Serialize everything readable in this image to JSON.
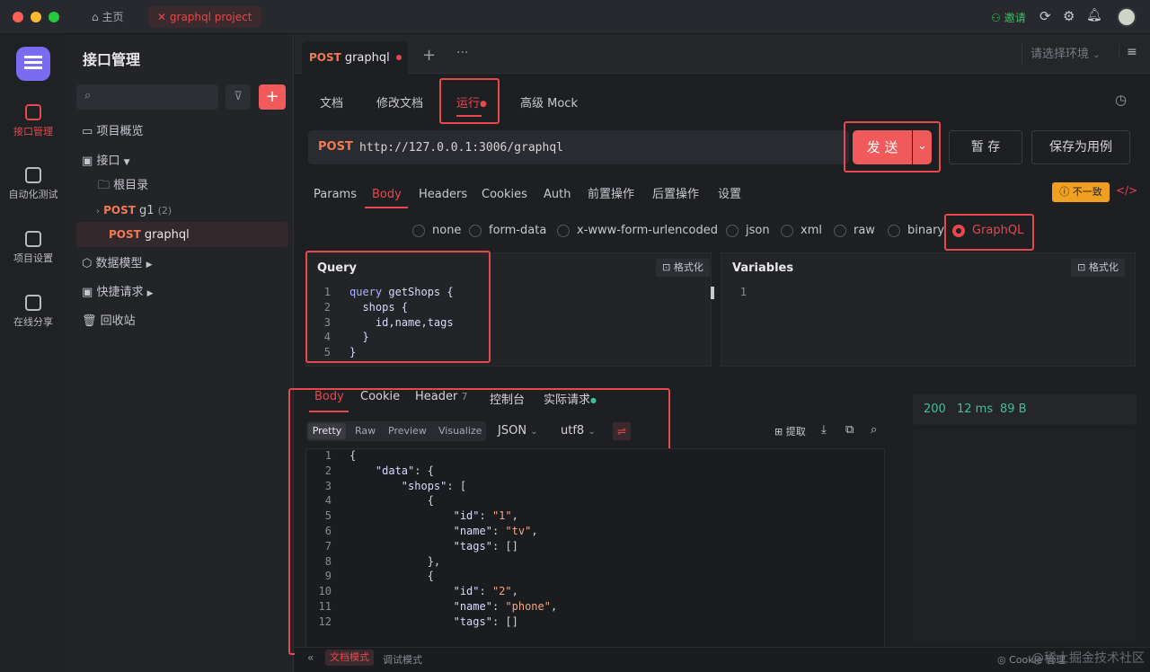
{
  "titlebar": {
    "home_label": "主页",
    "project_tab": "graphql project",
    "invite": "邀请"
  },
  "rail": [
    {
      "label": "接口管理",
      "icon": "api-manage-icon",
      "active": true
    },
    {
      "label": "自动化测试",
      "icon": "automation-icon",
      "active": false
    },
    {
      "label": "项目设置",
      "icon": "settings-icon",
      "active": false
    },
    {
      "label": "在线分享",
      "icon": "share-icon",
      "active": false
    }
  ],
  "tree": {
    "title": "接口管理",
    "overview": "项目概览",
    "interfaces": "接口",
    "root": "根目录",
    "g1": {
      "method": "POST",
      "name": "g1",
      "count": "(2)"
    },
    "graphql": {
      "method": "POST",
      "name": "graphql"
    },
    "models": "数据模型",
    "quick": "快捷请求",
    "trash": "回收站"
  },
  "request_tab": {
    "method": "POST",
    "name": "graphql",
    "env_placeholder": "请选择环境"
  },
  "subtabs": {
    "doc": "文档",
    "edit": "修改文档",
    "run": "运行",
    "mock": "高级 Mock"
  },
  "url_bar": {
    "method": "POST",
    "url": "http://127.0.0.1:3006/graphql",
    "send": "发 送",
    "save_temp": "暂 存",
    "save_case": "保存为用例"
  },
  "param_tabs": [
    "Params",
    "Body",
    "Headers",
    "Cookies",
    "Auth",
    "前置操作",
    "后置操作",
    "设置"
  ],
  "mismatch": "不一致",
  "body_types": [
    "none",
    "form-data",
    "x-www-form-urlencoded",
    "json",
    "xml",
    "raw",
    "binary",
    "GraphQL"
  ],
  "query": {
    "title": "Query",
    "format": "格式化",
    "lines": [
      "1",
      "2",
      "3",
      "4",
      "5"
    ]
  },
  "variables": {
    "title": "Variables",
    "format": "格式化",
    "lines": [
      "1"
    ]
  },
  "response": {
    "tabs": {
      "body": "Body",
      "cookie": "Cookie",
      "header": "Header",
      "header_count": "7",
      "console": "控制台",
      "actual": "实际请求"
    },
    "status": "200",
    "time": "12 ms",
    "size": "89 B",
    "views": [
      "Pretty",
      "Raw",
      "Preview",
      "Visualize"
    ],
    "format": "JSON",
    "encoding": "utf8",
    "extract": "提取",
    "lines": [
      "1",
      "2",
      "3",
      "4",
      "5",
      "6",
      "7",
      "8",
      "9",
      "10",
      "11",
      "12"
    ]
  },
  "footer": {
    "doc_mode": "文档模式",
    "debug_mode": "调试模式",
    "cookie": "Cookie 管理",
    "watermark": "@稀土掘金技术社区"
  }
}
